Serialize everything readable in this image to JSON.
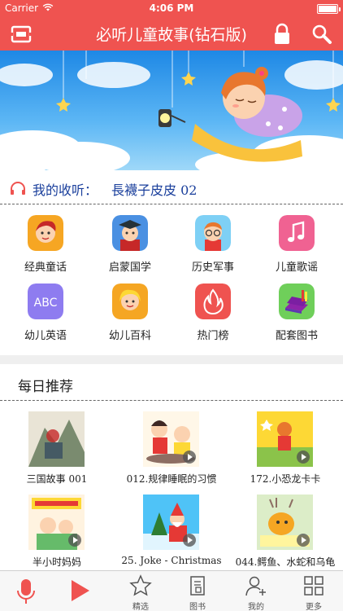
{
  "status_bar": {
    "carrier": "Carrier",
    "time": "4:06 PM"
  },
  "nav": {
    "title": "必听儿童故事(钻石版)",
    "menu_icon": "menu-icon",
    "lock_icon": "lock-icon",
    "search_icon": "search-icon"
  },
  "banner": {
    "page_count": 5,
    "active_page": 4
  },
  "listening": {
    "label": "我的收听：",
    "value": "長襪子皮皮 02"
  },
  "categories": [
    {
      "label": "经典童话",
      "icon": "fairy-tale-icon",
      "color": "#f6a623"
    },
    {
      "label": "启蒙国学",
      "icon": "scholar-icon",
      "color": "#4a90e2"
    },
    {
      "label": "历史军事",
      "icon": "history-icon",
      "color": "#7ed0f5"
    },
    {
      "label": "儿童歌谣",
      "icon": "music-note-icon",
      "color": "#f06292"
    },
    {
      "label": "幼儿英语",
      "icon": "abc-icon",
      "color": "#8e7cf0"
    },
    {
      "label": "幼儿百科",
      "icon": "encyclopedia-icon",
      "color": "#f5a623"
    },
    {
      "label": "热门榜",
      "icon": "fire-icon",
      "color": "#ef5350"
    },
    {
      "label": "配套图书",
      "icon": "books-icon",
      "color": "#6fcf5a"
    }
  ],
  "daily": {
    "title": "每日推荐",
    "books": [
      {
        "title": "三国故事 001"
      },
      {
        "title": "012.规律睡眠的习惯"
      },
      {
        "title": "172.小恐龙卡卡"
      },
      {
        "title": "半小时妈妈"
      },
      {
        "title": "25. Joke - Christmas"
      },
      {
        "title": "044.鳄鱼、水蛇和乌龟"
      }
    ]
  },
  "tabbar": {
    "tabs": [
      {
        "label": "精选",
        "icon": "star-icon"
      },
      {
        "label": "图书",
        "icon": "book-icon"
      },
      {
        "label": "我的",
        "icon": "user-add-icon"
      },
      {
        "label": "更多",
        "icon": "grid-icon"
      }
    ]
  },
  "colors": {
    "accent": "#ef5350",
    "link": "#1a3f9c"
  }
}
